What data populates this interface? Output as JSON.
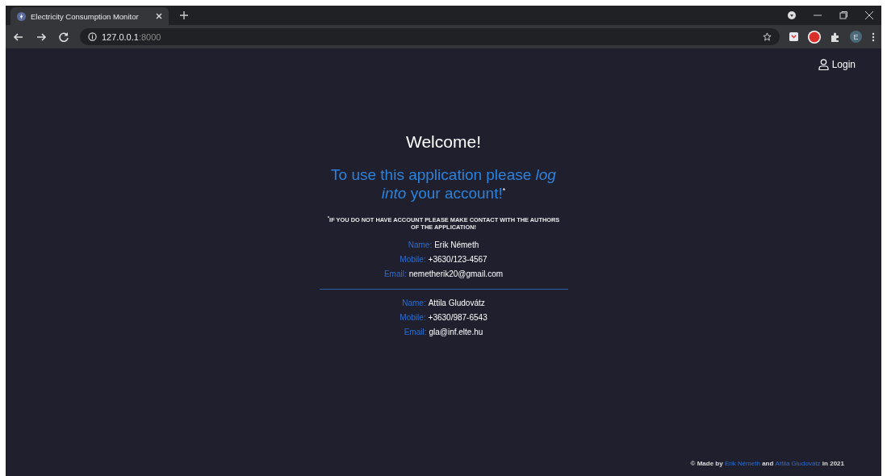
{
  "browser": {
    "tab": {
      "title": "Electricity Consumption Monitor",
      "selected": true
    },
    "url_host": "127.0.0.1",
    "url_port": ":8000",
    "profile_initial": "E"
  },
  "header": {
    "login": "Login"
  },
  "welcome": {
    "title": "Welcome!",
    "subtitle": "To use this application please *log into* your account!$^{*}$",
    "note": "$^{*}$IF YOU DO NOT HAVE ACCOUNT PLEASE MAKE CONTACT WITH THE AUTHORS OF THE APPLICATION!"
  },
  "contacts": [
    {
      "fields": [
        {
          "label": "Name:",
          "value": "Erik Németh"
        },
        {
          "label": "Mobile:",
          "value": "+3630/123-4567"
        },
        {
          "label": "Email:",
          "value": "nemetherik20@gmail.com"
        }
      ]
    },
    {
      "fields": [
        {
          "label": "Name:",
          "value": "Attila Gludovátz"
        },
        {
          "label": "Mobile:",
          "value": "+3630/987-6543"
        },
        {
          "label": "Email:",
          "value": "gla@inf.elte.hu"
        }
      ]
    }
  ],
  "footer": {
    "prefix": "© Made by",
    "authors": [
      "Erik Németh",
      "Attila Gludovátz"
    ],
    "joiner": "and",
    "suffix": "in 2021"
  }
}
